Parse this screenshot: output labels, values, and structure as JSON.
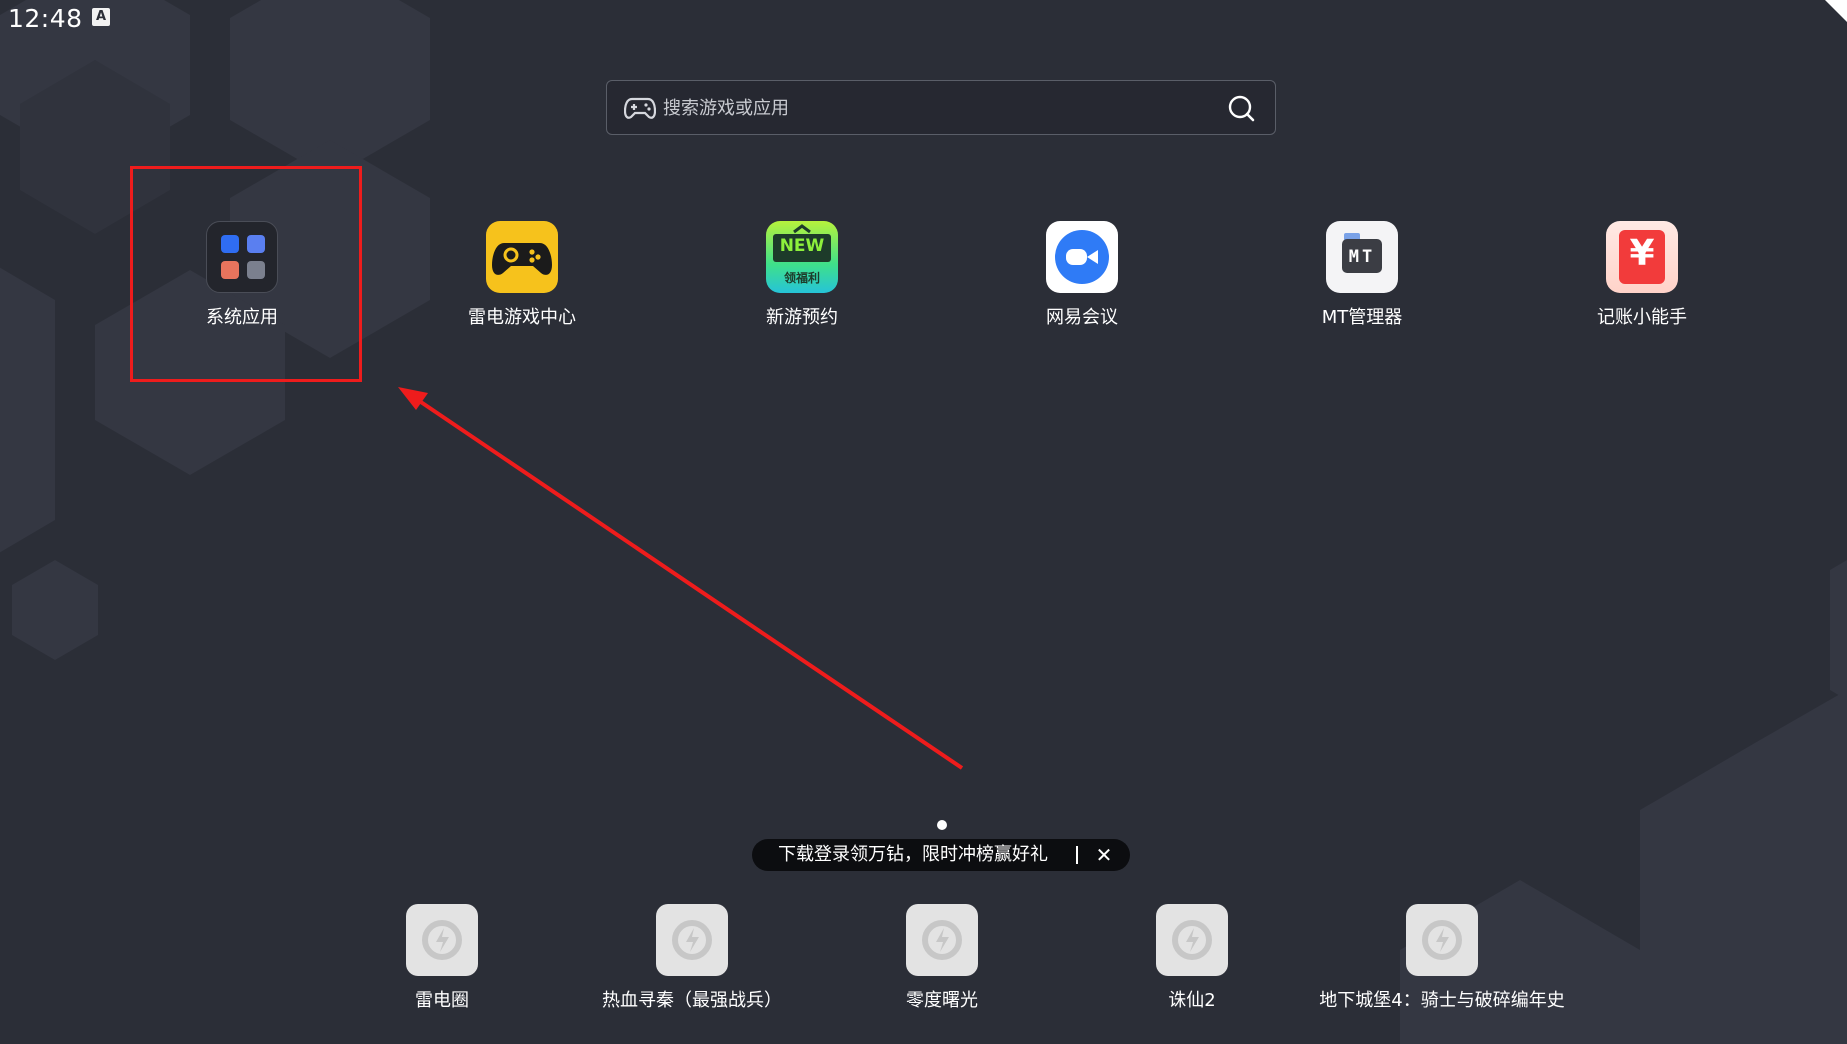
{
  "status": {
    "time": "12:48",
    "notif_glyph": "A"
  },
  "search": {
    "placeholder": "搜索游戏或应用",
    "left_icon": "gamepad-icon",
    "right_icon": "search-icon"
  },
  "apps": [
    {
      "label": "系统应用",
      "icon": "folder-icon"
    },
    {
      "label": "雷电游戏中心",
      "icon": "gamepad-icon"
    },
    {
      "label": "新游预约",
      "icon": "new-badge-icon",
      "badge_text": "NEW",
      "badge_sub": "领福利"
    },
    {
      "label": "网易会议",
      "icon": "video-camera-icon"
    },
    {
      "label": "MT管理器",
      "icon": "mt-manager-icon",
      "badge_text": "MT"
    },
    {
      "label": "记账小能手",
      "icon": "yuan-icon",
      "badge_text": "¥"
    }
  ],
  "promo": {
    "text": "下载登录领万钻，限时冲榜赢好礼",
    "close": "✕"
  },
  "dock": [
    {
      "label": "雷电圈"
    },
    {
      "label": "热血寻秦（最强战兵）"
    },
    {
      "label": "零度曙光"
    },
    {
      "label": "诛仙2"
    },
    {
      "label": "地下城堡4：骑士与破碎编年史"
    }
  ],
  "colors": {
    "background": "#2b2e37",
    "annotation": "#ee1c1c",
    "gamecenter_yellow": "#f6c21c",
    "meeting_blue": "#2f7bf6"
  }
}
